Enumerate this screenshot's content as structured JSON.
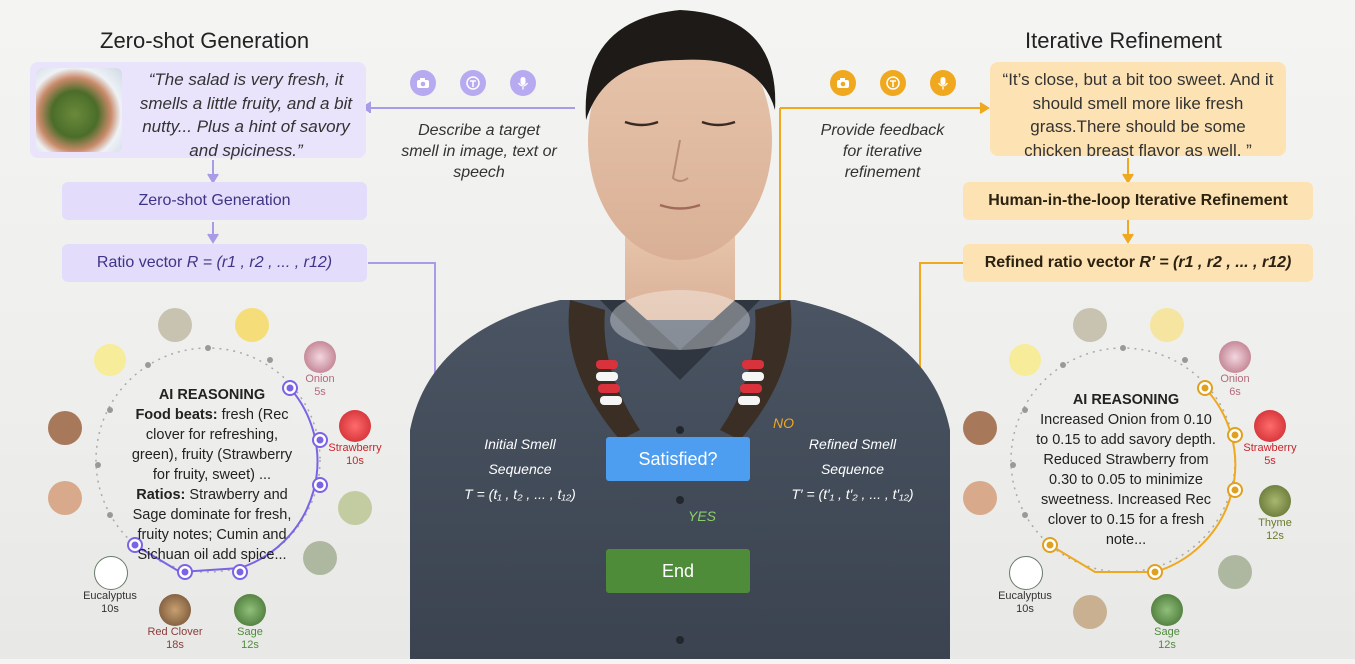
{
  "left": {
    "title": "Zero-shot Generation",
    "quote": "“The salad is very fresh, it smells a little fruity, and a bit nutty... Plus a hint of savory and spiciness.”",
    "describe": "Describe a target smell in image, text or speech",
    "generation_box": "Zero-shot Generation",
    "ratio_prefix": "Ratio vector ",
    "ratio_formula": "R = (r1 , r2 , ... , r12)",
    "reasoning_title": "AI REASONING",
    "reasoning_food_label": "Food beats:",
    "reasoning_food": " fresh (Rec clover for refreshing, green), fruity (Strawberry for fruity, sweet) ...",
    "reasoning_ratios_label": "Ratios:",
    "reasoning_ratios": " Strawberry and Sage dominate for fresh, fruity notes; Cumin and Sichuan oil add spice...",
    "ingredients": [
      {
        "name": "Onion",
        "time": "5s",
        "color": "#b46a7c"
      },
      {
        "name": "Strawberry",
        "time": "10s",
        "color": "#c8242b"
      },
      {
        "name": "Eucalyptus",
        "time": "10s",
        "color": "#333333"
      },
      {
        "name": "Red Clover",
        "time": "18s",
        "color": "#8b3c3c"
      },
      {
        "name": "Sage",
        "time": "12s",
        "color": "#4e8c3a"
      }
    ]
  },
  "right": {
    "title": "Iterative Refinement",
    "quote": "“It’s close, but a bit too sweet. And it should smell more like fresh grass.There should be some chicken breast flavor as well. ”",
    "describe": "Provide feedback for iterative refinement",
    "refine_box": "Human-in-the-loop Iterative Refinement",
    "ratio_prefix": "Refined ratio vector ",
    "ratio_formula": "R′ = (r1 , r2 , ... , r12)",
    "reasoning_title": "AI REASONING",
    "reasoning": "Increased Onion from 0.10 to 0.15 to add savory depth. Reduced Strawberry from 0.30 to 0.05 to minimize sweetness. Increased Rec clover to 0.15 for a fresh note...",
    "ingredients": [
      {
        "name": "Onion",
        "time": "6s",
        "color": "#b46a7c"
      },
      {
        "name": "Strawberry",
        "time": "5s",
        "color": "#c8242b"
      },
      {
        "name": "Thyme",
        "time": "12s",
        "color": "#6a7a2c"
      },
      {
        "name": "Eucalyptus",
        "time": "10s",
        "color": "#333333"
      },
      {
        "name": "Sage",
        "time": "12s",
        "color": "#4e8c3a"
      }
    ]
  },
  "center": {
    "initial_seq_1": "Initial Smell",
    "initial_seq_2": "Sequence",
    "initial_seq_3": "T = (t₁ , t₂ , ... , t₁₂)",
    "refined_seq_1": "Refined Smell",
    "refined_seq_2": "Sequence",
    "refined_seq_3": "T′ = (t′₁ , t′₂ , ... , t′₁₂)",
    "satisfied": "Satisfied?",
    "no": "NO",
    "yes": "YES",
    "end": "End"
  },
  "colors": {
    "purple": "#7b63e6",
    "orange": "#f0a81e",
    "blue": "#4d9ef0",
    "green": "#4e8c3a"
  }
}
